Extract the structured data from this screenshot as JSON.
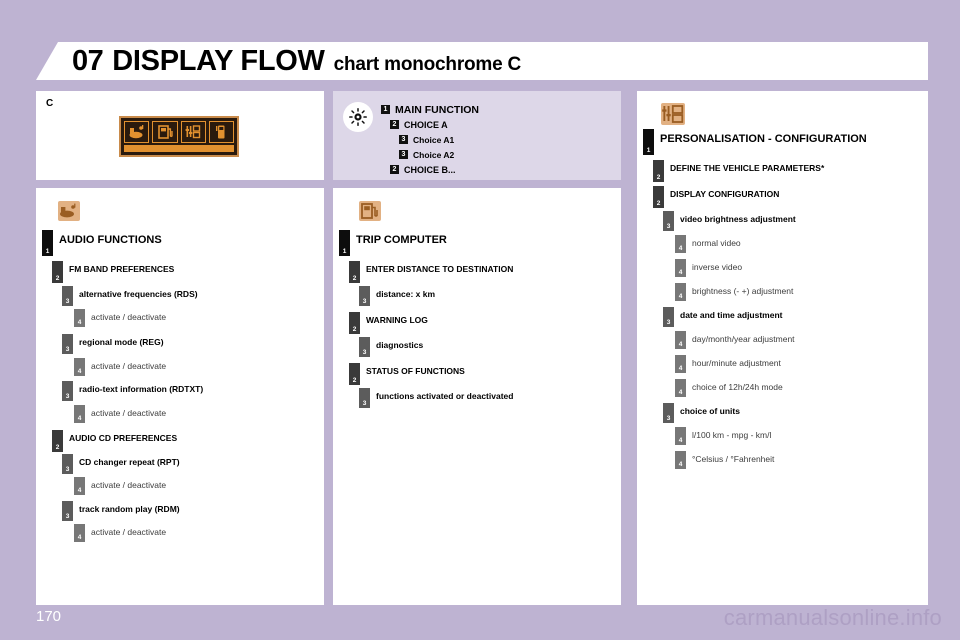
{
  "header": {
    "chapter_number": "07",
    "title": "DISPLAY FLOW",
    "subtitle": "chart monochrome C"
  },
  "display_panel": {
    "corner_label": "C",
    "screen_icons": [
      "audio-icon",
      "trip-computer-icon",
      "personalisation-icon",
      "telephone-icon"
    ]
  },
  "legend_panel": {
    "icon": "sun-brightness-icon",
    "rows": [
      {
        "level": "1",
        "label": "MAIN FUNCTION"
      },
      {
        "level": "2",
        "label": "CHOICE A"
      },
      {
        "level": "3",
        "label": "Choice A1"
      },
      {
        "level": "3",
        "label": "Choice A2"
      },
      {
        "level": "2",
        "label": "CHOICE B..."
      }
    ]
  },
  "audio_panel": {
    "icon": "audio-functions-icon",
    "nodes": [
      {
        "level": 1,
        "label": "AUDIO FUNCTIONS"
      },
      {
        "level": 2,
        "label": "FM BAND PREFERENCES"
      },
      {
        "level": 3,
        "label": "alternative frequencies (RDS)"
      },
      {
        "level": 4,
        "label": "activate / deactivate"
      },
      {
        "level": 3,
        "label": "regional mode (REG)"
      },
      {
        "level": 4,
        "label": "activate / deactivate"
      },
      {
        "level": 3,
        "label": "radio-text information (RDTXT)"
      },
      {
        "level": 4,
        "label": "activate / deactivate"
      },
      {
        "level": 2,
        "label": "AUDIO CD PREFERENCES"
      },
      {
        "level": 3,
        "label": "CD changer repeat (RPT)"
      },
      {
        "level": 4,
        "label": "activate / deactivate"
      },
      {
        "level": 3,
        "label": "track random play (RDM)"
      },
      {
        "level": 4,
        "label": "activate / deactivate"
      }
    ]
  },
  "trip_panel": {
    "icon": "trip-computer-icon",
    "nodes": [
      {
        "level": 1,
        "label": "TRIP COMPUTER"
      },
      {
        "level": 2,
        "label": "ENTER DISTANCE TO DESTINATION"
      },
      {
        "level": 3,
        "label": "distance: x km"
      },
      {
        "level": 2,
        "label": "WARNING LOG"
      },
      {
        "level": 3,
        "label": "diagnostics"
      },
      {
        "level": 2,
        "label": "STATUS OF FUNCTIONS"
      },
      {
        "level": 3,
        "label": "functions activated or deactivated"
      }
    ]
  },
  "personalisation_panel": {
    "icon": "personalisation-icon",
    "nodes": [
      {
        "level": 1,
        "label": "PERSONALISATION - CONFIGURATION"
      },
      {
        "level": 2,
        "label": "DEFINE THE VEHICLE PARAMETERS*"
      },
      {
        "level": 2,
        "label": "DISPLAY CONFIGURATION"
      },
      {
        "level": 3,
        "label": "video brightness adjustment"
      },
      {
        "level": 4,
        "label": "normal video"
      },
      {
        "level": 4,
        "label": "inverse video"
      },
      {
        "level": 4,
        "label": "brightness (- +) adjustment"
      },
      {
        "level": 3,
        "label": "date and time adjustment"
      },
      {
        "level": 4,
        "label": "day/month/year adjustment"
      },
      {
        "level": 4,
        "label": "hour/minute adjustment"
      },
      {
        "level": 4,
        "label": "choice of 12h/24h mode"
      },
      {
        "level": 3,
        "label": "choice of units"
      },
      {
        "level": 4,
        "label": "l/100  km - mpg - km/l"
      },
      {
        "level": 4,
        "label": "°Celsius / °Fahrenheit"
      }
    ]
  },
  "footer": {
    "page_number": "170",
    "watermark": "carmanualsonline.info"
  },
  "colors": {
    "page_background": "#beb3d2",
    "panel_background": "#ffffff",
    "legend_background": "#ddd7e8",
    "badge_level1": "#0d0d0d",
    "badge_level2": "#3a3a3a",
    "badge_level3": "#5c5c5c",
    "badge_level4": "#777777",
    "screen_amber": "#e2912f",
    "icon_tan": "#d9a56b"
  }
}
